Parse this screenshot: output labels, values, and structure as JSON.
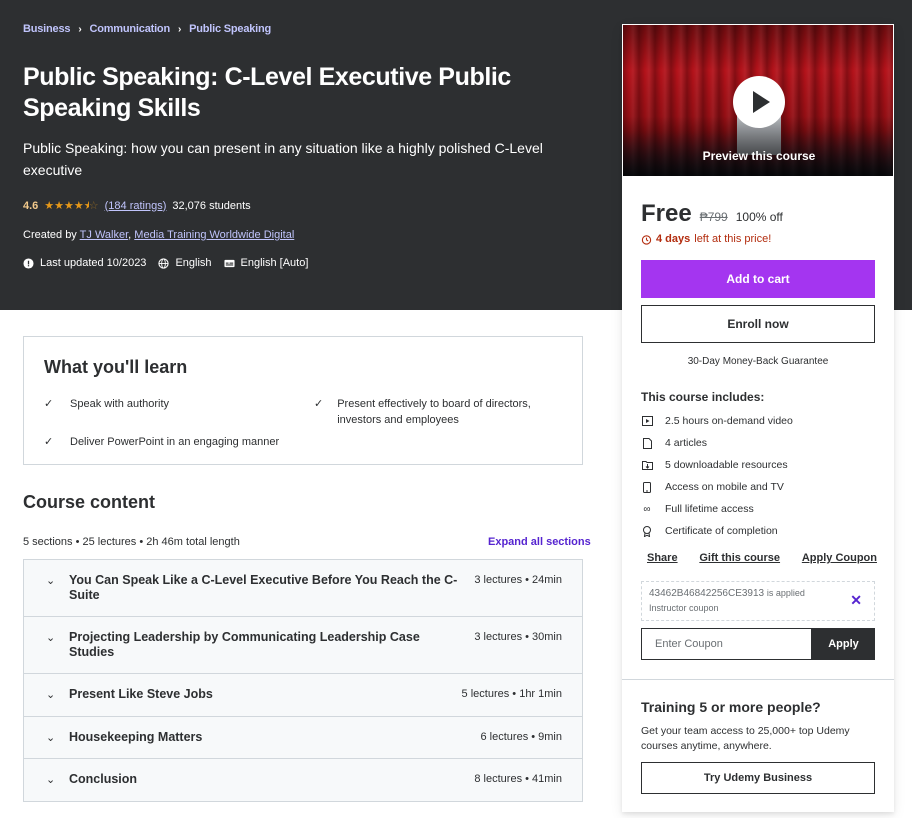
{
  "breadcrumbs": [
    "Business",
    "Communication",
    "Public Speaking"
  ],
  "course": {
    "title": "Public Speaking: C-Level Executive Public Speaking Skills",
    "subtitle": "Public Speaking: how you can present in any situation like a highly polished C-Level executive",
    "rating": "4.6",
    "stars_value": 4.5,
    "ratings_count": "(184 ratings)",
    "students": "32,076 students",
    "created_by_label": "Created by",
    "instructor_1": "TJ Walker",
    "instructor_2": "Media Training Worldwide Digital",
    "last_updated": "Last updated 10/2023",
    "language": "English",
    "captions": "English [Auto]"
  },
  "learn": {
    "title": "What you'll learn",
    "items": [
      "Speak with authority",
      "Present effectively to board of directors, investors and employees",
      "Deliver PowerPoint in an engaging manner"
    ]
  },
  "content": {
    "title": "Course content",
    "summary": "5 sections • 25 lectures • 2h 46m total length",
    "expand_label": "Expand all sections",
    "sections": [
      {
        "name": "You Can Speak Like a C-Level Executive Before You Reach the C-Suite",
        "info": "3 lectures • 24min"
      },
      {
        "name": "Projecting Leadership by Communicating Leadership Case Studies",
        "info": "3 lectures • 30min"
      },
      {
        "name": "Present Like Steve Jobs",
        "info": "5 lectures • 1hr 1min"
      },
      {
        "name": "Housekeeping Matters",
        "info": "6 lectures • 9min"
      },
      {
        "name": "Conclusion",
        "info": "8 lectures • 41min"
      }
    ]
  },
  "sidebar": {
    "preview_label": "Preview this course",
    "price_now": "Free",
    "price_old": "₱799",
    "discount": "100% off",
    "deadline_bold": "4 days",
    "deadline_rest": "left at this price!",
    "add_to_cart": "Add to cart",
    "enroll_now": "Enroll now",
    "guarantee": "30-Day Money-Back Guarantee",
    "includes_title": "This course includes:",
    "includes": [
      {
        "icon": "video-icon",
        "label": "2.5 hours on-demand video"
      },
      {
        "icon": "article-icon",
        "label": "4 articles"
      },
      {
        "icon": "download-icon",
        "label": "5 downloadable resources"
      },
      {
        "icon": "mobile-icon",
        "label": "Access on mobile and TV"
      },
      {
        "icon": "infinity-icon",
        "label": "Full lifetime access"
      },
      {
        "icon": "certificate-icon",
        "label": "Certificate of completion"
      }
    ],
    "share": "Share",
    "gift": "Gift this course",
    "apply_coupon": "Apply Coupon",
    "coupon_code": "43462B46842256CE3913",
    "coupon_applied_text": "is applied",
    "coupon_sub": "Instructor coupon",
    "coupon_placeholder": "Enter Coupon",
    "coupon_apply_btn": "Apply",
    "team_title": "Training 5 or more people?",
    "team_desc": "Get your team access to 25,000+ top Udemy courses anytime, anywhere.",
    "business_btn": "Try Udemy Business"
  },
  "colors": {
    "hero_bg": "#2d2f31",
    "link_purple": "#c0c4fc",
    "accent_purple": "#a435f0",
    "star_orange": "#e59819",
    "deadline_red": "#b32d0f"
  }
}
